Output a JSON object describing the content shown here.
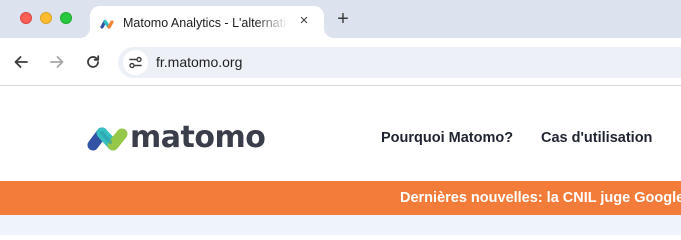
{
  "browser": {
    "tab": {
      "title": "Matomo Analytics - L'alternative",
      "close_icon": "×",
      "favicon_icon": "matomo-favicon"
    },
    "new_tab_icon": "+",
    "toolbar": {
      "back_icon": "back-arrow",
      "forward_icon": "forward-arrow",
      "reload_icon": "reload",
      "site_info_icon": "tune",
      "url": "fr.matomo.org"
    }
  },
  "site": {
    "logo_text": "matomo",
    "nav": {
      "why": "Pourquoi Matomo?",
      "use_cases": "Cas d'utilisation"
    },
    "news_banner": "Dernières nouvelles: la CNIL juge Google"
  },
  "colors": {
    "banner": "#f47c3a",
    "logo_teal": "#35bfc0",
    "logo_blue": "#3253a3",
    "logo_green": "#95c748"
  }
}
